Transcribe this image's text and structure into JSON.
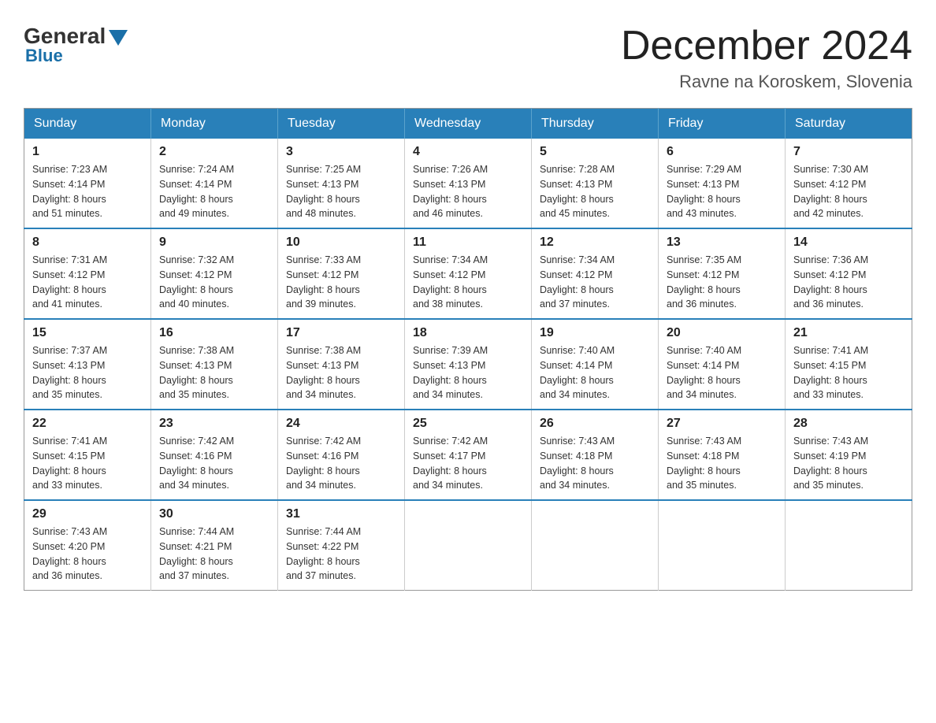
{
  "logo": {
    "general": "General",
    "blue": "Blue"
  },
  "title": "December 2024",
  "subtitle": "Ravne na Koroskem, Slovenia",
  "weekdays": [
    "Sunday",
    "Monday",
    "Tuesday",
    "Wednesday",
    "Thursday",
    "Friday",
    "Saturday"
  ],
  "weeks": [
    [
      {
        "day": "1",
        "sunrise": "7:23 AM",
        "sunset": "4:14 PM",
        "daylight": "8 hours and 51 minutes."
      },
      {
        "day": "2",
        "sunrise": "7:24 AM",
        "sunset": "4:14 PM",
        "daylight": "8 hours and 49 minutes."
      },
      {
        "day": "3",
        "sunrise": "7:25 AM",
        "sunset": "4:13 PM",
        "daylight": "8 hours and 48 minutes."
      },
      {
        "day": "4",
        "sunrise": "7:26 AM",
        "sunset": "4:13 PM",
        "daylight": "8 hours and 46 minutes."
      },
      {
        "day": "5",
        "sunrise": "7:28 AM",
        "sunset": "4:13 PM",
        "daylight": "8 hours and 45 minutes."
      },
      {
        "day": "6",
        "sunrise": "7:29 AM",
        "sunset": "4:13 PM",
        "daylight": "8 hours and 43 minutes."
      },
      {
        "day": "7",
        "sunrise": "7:30 AM",
        "sunset": "4:12 PM",
        "daylight": "8 hours and 42 minutes."
      }
    ],
    [
      {
        "day": "8",
        "sunrise": "7:31 AM",
        "sunset": "4:12 PM",
        "daylight": "8 hours and 41 minutes."
      },
      {
        "day": "9",
        "sunrise": "7:32 AM",
        "sunset": "4:12 PM",
        "daylight": "8 hours and 40 minutes."
      },
      {
        "day": "10",
        "sunrise": "7:33 AM",
        "sunset": "4:12 PM",
        "daylight": "8 hours and 39 minutes."
      },
      {
        "day": "11",
        "sunrise": "7:34 AM",
        "sunset": "4:12 PM",
        "daylight": "8 hours and 38 minutes."
      },
      {
        "day": "12",
        "sunrise": "7:34 AM",
        "sunset": "4:12 PM",
        "daylight": "8 hours and 37 minutes."
      },
      {
        "day": "13",
        "sunrise": "7:35 AM",
        "sunset": "4:12 PM",
        "daylight": "8 hours and 36 minutes."
      },
      {
        "day": "14",
        "sunrise": "7:36 AM",
        "sunset": "4:12 PM",
        "daylight": "8 hours and 36 minutes."
      }
    ],
    [
      {
        "day": "15",
        "sunrise": "7:37 AM",
        "sunset": "4:13 PM",
        "daylight": "8 hours and 35 minutes."
      },
      {
        "day": "16",
        "sunrise": "7:38 AM",
        "sunset": "4:13 PM",
        "daylight": "8 hours and 35 minutes."
      },
      {
        "day": "17",
        "sunrise": "7:38 AM",
        "sunset": "4:13 PM",
        "daylight": "8 hours and 34 minutes."
      },
      {
        "day": "18",
        "sunrise": "7:39 AM",
        "sunset": "4:13 PM",
        "daylight": "8 hours and 34 minutes."
      },
      {
        "day": "19",
        "sunrise": "7:40 AM",
        "sunset": "4:14 PM",
        "daylight": "8 hours and 34 minutes."
      },
      {
        "day": "20",
        "sunrise": "7:40 AM",
        "sunset": "4:14 PM",
        "daylight": "8 hours and 34 minutes."
      },
      {
        "day": "21",
        "sunrise": "7:41 AM",
        "sunset": "4:15 PM",
        "daylight": "8 hours and 33 minutes."
      }
    ],
    [
      {
        "day": "22",
        "sunrise": "7:41 AM",
        "sunset": "4:15 PM",
        "daylight": "8 hours and 33 minutes."
      },
      {
        "day": "23",
        "sunrise": "7:42 AM",
        "sunset": "4:16 PM",
        "daylight": "8 hours and 34 minutes."
      },
      {
        "day": "24",
        "sunrise": "7:42 AM",
        "sunset": "4:16 PM",
        "daylight": "8 hours and 34 minutes."
      },
      {
        "day": "25",
        "sunrise": "7:42 AM",
        "sunset": "4:17 PM",
        "daylight": "8 hours and 34 minutes."
      },
      {
        "day": "26",
        "sunrise": "7:43 AM",
        "sunset": "4:18 PM",
        "daylight": "8 hours and 34 minutes."
      },
      {
        "day": "27",
        "sunrise": "7:43 AM",
        "sunset": "4:18 PM",
        "daylight": "8 hours and 35 minutes."
      },
      {
        "day": "28",
        "sunrise": "7:43 AM",
        "sunset": "4:19 PM",
        "daylight": "8 hours and 35 minutes."
      }
    ],
    [
      {
        "day": "29",
        "sunrise": "7:43 AM",
        "sunset": "4:20 PM",
        "daylight": "8 hours and 36 minutes."
      },
      {
        "day": "30",
        "sunrise": "7:44 AM",
        "sunset": "4:21 PM",
        "daylight": "8 hours and 37 minutes."
      },
      {
        "day": "31",
        "sunrise": "7:44 AM",
        "sunset": "4:22 PM",
        "daylight": "8 hours and 37 minutes."
      },
      null,
      null,
      null,
      null
    ]
  ],
  "labels": {
    "sunrise": "Sunrise:",
    "sunset": "Sunset:",
    "daylight": "Daylight:"
  }
}
